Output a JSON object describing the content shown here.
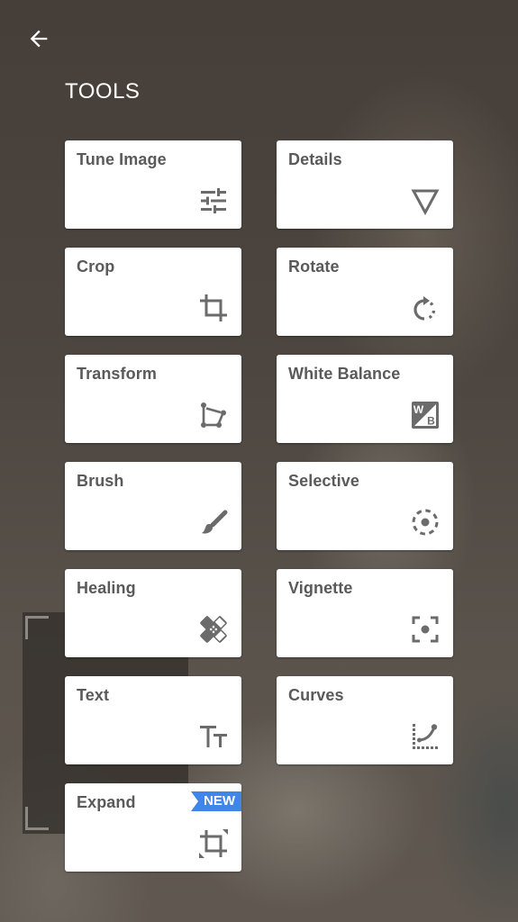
{
  "header": {
    "back_icon": "arrow-left-icon",
    "title": "TOOLS"
  },
  "colors": {
    "card_bg": "#ffffff",
    "label": "#5a5a5a",
    "icon": "#6b6b6b",
    "badge_bg": "#3f86e8",
    "badge_text": "#ffffff",
    "title_text": "#ffffff"
  },
  "tools": [
    {
      "label": "Tune Image",
      "icon": "sliders-icon"
    },
    {
      "label": "Details",
      "icon": "triangle-down-icon"
    },
    {
      "label": "Crop",
      "icon": "crop-icon"
    },
    {
      "label": "Rotate",
      "icon": "rotate-icon"
    },
    {
      "label": "Transform",
      "icon": "perspective-icon"
    },
    {
      "label": "White Balance",
      "icon": "white-balance-icon"
    },
    {
      "label": "Brush",
      "icon": "brush-icon"
    },
    {
      "label": "Selective",
      "icon": "selective-target-icon"
    },
    {
      "label": "Healing",
      "icon": "bandage-icon"
    },
    {
      "label": "Vignette",
      "icon": "vignette-focus-icon"
    },
    {
      "label": "Text",
      "icon": "text-size-icon"
    },
    {
      "label": "Curves",
      "icon": "curves-icon"
    },
    {
      "label": "Expand",
      "icon": "expand-crop-icon",
      "badge": "NEW"
    }
  ],
  "wb_icon": {
    "top": "W",
    "bottom": "B"
  }
}
